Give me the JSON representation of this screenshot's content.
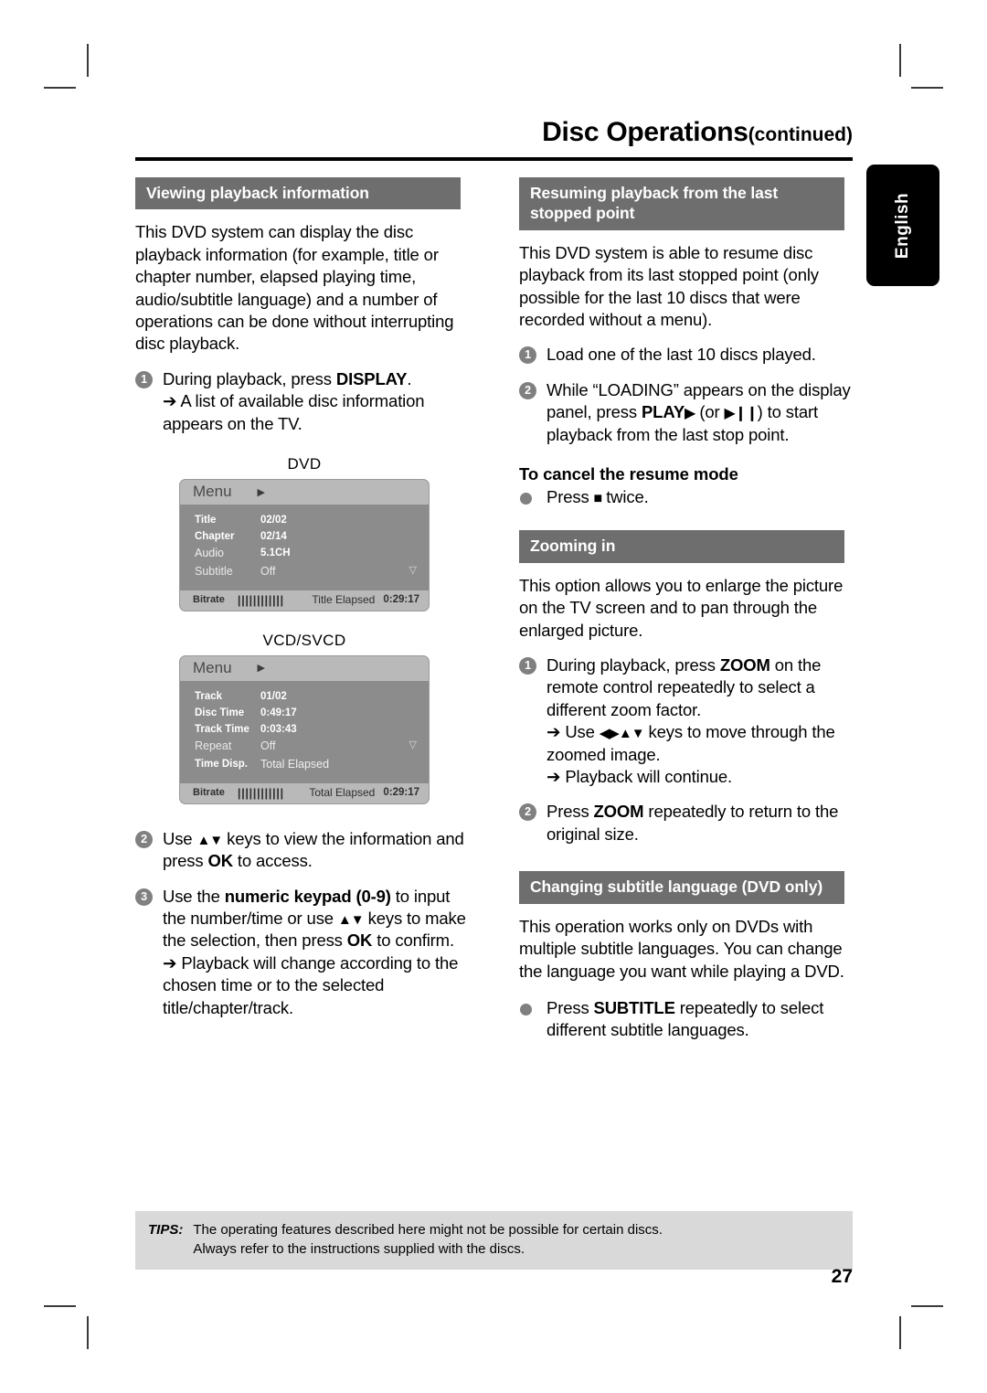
{
  "page": {
    "title": "Disc Operations",
    "title_suffix": "(continued)",
    "number": "27",
    "language_tab": "English"
  },
  "left_column": {
    "section1": {
      "heading": "Viewing playback information",
      "intro": "This DVD system can display the disc playback information (for example, title or chapter number, elapsed playing time, audio/subtitle language) and a number of operations can be done without interrupting disc playback.",
      "step1_num": "1",
      "step1_text_a": "During playback, press ",
      "step1_bold": "DISPLAY",
      "step1_text_b": ".",
      "step1_arrow": "➔ A list of available disc information appears on the TV."
    },
    "osd_dvd": {
      "caption": "DVD",
      "menu_label": "Menu",
      "menu_arrow": "▶",
      "rows": [
        {
          "label": "Title",
          "value": "02/02",
          "style": "bold"
        },
        {
          "label": "Chapter",
          "value": "02/14",
          "style": "bold"
        },
        {
          "label": "Audio",
          "value": "5.1CH",
          "style": "mixed"
        },
        {
          "label": "Subtitle",
          "value": "Off",
          "style": "plain"
        }
      ],
      "down_arrow": "▽",
      "bitrate_label": "Bitrate",
      "bitrate_bars": "||||||||||||",
      "elapsed_label": "Title Elapsed",
      "elapsed_value": "0:29:17"
    },
    "osd_vcd": {
      "caption": "VCD/SVCD",
      "menu_label": "Menu",
      "menu_arrow": "▶",
      "rows": [
        {
          "label": "Track",
          "value": "01/02",
          "style": "bold"
        },
        {
          "label": "Disc Time",
          "value": "0:49:17",
          "style": "bold"
        },
        {
          "label": "Track Time",
          "value": "0:03:43",
          "style": "bold"
        },
        {
          "label": "Repeat",
          "value": "Off",
          "style": "plain"
        },
        {
          "label": "Time Disp.",
          "value": "Total Elapsed",
          "style": "mixed"
        }
      ],
      "down_arrow": "▽",
      "bitrate_label": "Bitrate",
      "bitrate_bars": "||||||||||||",
      "elapsed_label": "Total Elapsed",
      "elapsed_value": "0:29:17"
    },
    "step2": {
      "num": "2",
      "text_a": "Use ",
      "keys": "▲▼",
      "text_b": " keys to view the information and press ",
      "bold": "OK",
      "text_c": " to access."
    },
    "step3": {
      "num": "3",
      "text_a": "Use the ",
      "bold1": "numeric keypad (0-9)",
      "text_b": " to input the number/time or use ",
      "keys": "▲▼",
      "text_c": " keys to make the selection, then press ",
      "bold2": "OK",
      "text_d": " to confirm.",
      "arrow": "➔ Playback will change according to the chosen time or to the selected title/chapter/track."
    }
  },
  "right_column": {
    "section_resume": {
      "heading": "Resuming playback from the last stopped point",
      "intro": "This DVD system is able to resume disc playback from its last stopped point (only possible for the last 10 discs that were recorded without a menu).",
      "step1_num": "1",
      "step1_text": "Load one of the last 10 discs played.",
      "step2_num": "2",
      "step2_text_a": "While “LOADING” appears on the display panel, press ",
      "step2_bold": "PLAY",
      "step2_glyph1": "▶",
      "step2_text_b": " (or ",
      "step2_glyph2": "▶❙❙",
      "step2_text_c": ") to start playback from the last stop point.",
      "cancel_heading": "To cancel the resume mode",
      "cancel_text_a": "Press ",
      "cancel_glyph": "■",
      "cancel_text_b": " twice."
    },
    "section_zoom": {
      "heading": "Zooming in",
      "intro": "This option allows you to enlarge the picture on the TV screen and to pan through the enlarged picture.",
      "step1_num": "1",
      "step1_text_a": "During playback, press ",
      "step1_bold": "ZOOM",
      "step1_text_b": " on the remote control repeatedly to select a different zoom factor.",
      "step1_arrow_a": "➔ Use ",
      "step1_arrow_keys": "◀▶▲▼",
      "step1_arrow_b": " keys to move through the zoomed image.",
      "step1_arrow2": "➔ Playback will continue.",
      "step2_num": "2",
      "step2_text_a": "Press ",
      "step2_bold": "ZOOM",
      "step2_text_b": " repeatedly to return to the original size."
    },
    "section_subtitle": {
      "heading": "Changing subtitle language (DVD only)",
      "intro": "This operation works only on DVDs with multiple subtitle languages. You can change the language you want while playing a DVD.",
      "bullet_text_a": "Press ",
      "bullet_bold": "SUBTITLE",
      "bullet_text_b": " repeatedly to select different subtitle languages."
    }
  },
  "tips": {
    "label": "TIPS:",
    "line1": "The operating features described here might not be possible for certain discs.",
    "line2": "Always refer to the instructions supplied with the discs."
  },
  "colors": {
    "section_header_bg": "#6e6e6e",
    "osd_body_bg": "#8c8c8c",
    "osd_bar_bg": "#b9b9b9",
    "tips_bg": "#d9d9d9",
    "bullet_gray": "#808080"
  }
}
